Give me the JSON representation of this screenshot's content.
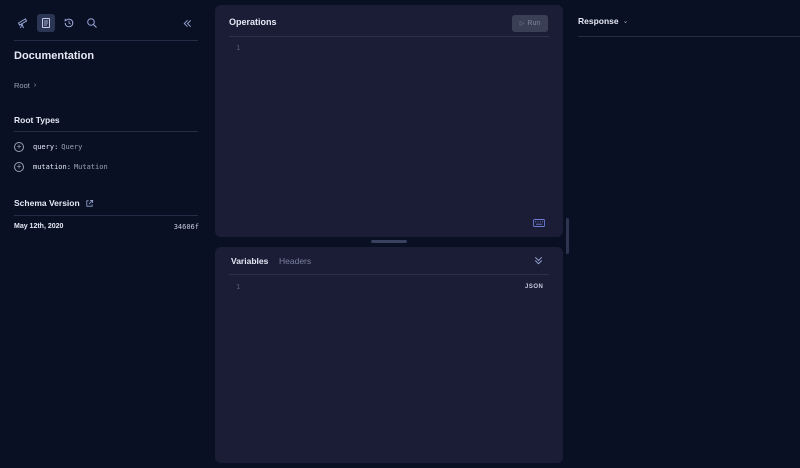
{
  "sidebar": {
    "title": "Documentation",
    "breadcrumb": "Root",
    "root_types_title": "Root Types",
    "root_types": [
      {
        "field": "query:",
        "type": "Query"
      },
      {
        "field": "mutation:",
        "type": "Mutation"
      }
    ],
    "schema_version_title": "Schema Version",
    "schema_date": "May 12th, 2020",
    "schema_hash": "34606f"
  },
  "operations": {
    "title": "Operations",
    "run_label": "Run",
    "line_number": "1"
  },
  "variables": {
    "tab_variables": "Variables",
    "tab_headers": "Headers",
    "line_number": "1",
    "format_label": "JSON"
  },
  "response": {
    "title": "Response"
  },
  "colors": {
    "background": "#0a1024",
    "panel": "#1a1d35",
    "accent": "#6b7bd6"
  }
}
